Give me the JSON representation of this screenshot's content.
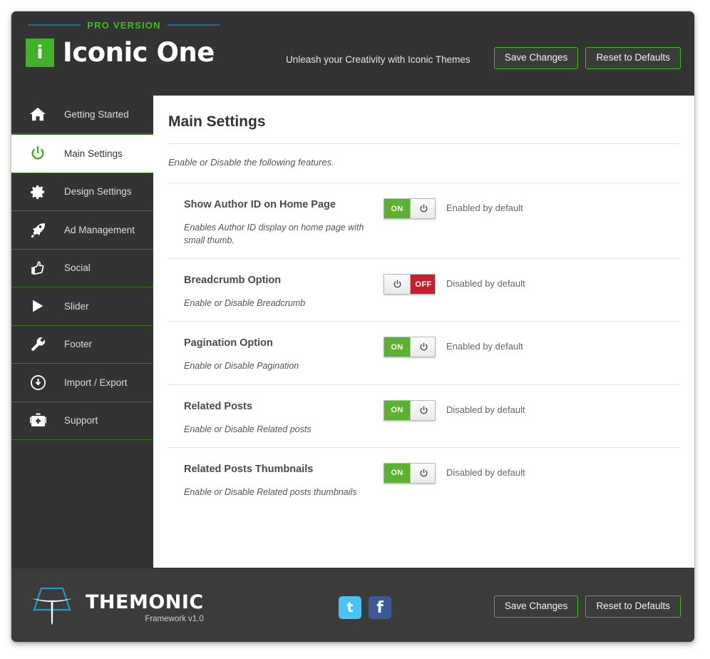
{
  "header": {
    "pro_label": "PRO  VERSION",
    "logo_mark": "i",
    "logo_text": "Iconic One",
    "tagline": "Unleash your Creativity with Iconic Themes",
    "save_label": "Save Changes",
    "reset_label": "Reset to Defaults"
  },
  "sidebar": {
    "items": [
      {
        "label": "Getting Started",
        "icon": "home-icon",
        "active": false
      },
      {
        "label": "Main Settings",
        "icon": "power-icon",
        "active": true
      },
      {
        "label": "Design Settings",
        "icon": "gear-icon",
        "active": false
      },
      {
        "label": "Ad Management",
        "icon": "rocket-icon",
        "active": false
      },
      {
        "label": "Social",
        "icon": "thumbs-up-icon",
        "active": false
      },
      {
        "label": "Slider",
        "icon": "play-icon",
        "active": false
      },
      {
        "label": "Footer",
        "icon": "wrench-icon",
        "active": false
      },
      {
        "label": "Import / Export",
        "icon": "download-circle-icon",
        "active": false
      },
      {
        "label": "Support",
        "icon": "briefcase-medical-icon",
        "active": false
      }
    ]
  },
  "main": {
    "title": "Main Settings",
    "subtitle": "Enable or Disable the following features.",
    "settings": [
      {
        "title": "Show Author ID on Home Page",
        "description": "Enables Author ID display on home page with small thumb.",
        "toggle_state": "ON",
        "toggle_label": "ON",
        "note": "Enabled by default"
      },
      {
        "title": "Breadcrumb Option",
        "description": "Enable or Disable Breadcrumb",
        "toggle_state": "OFF",
        "toggle_label": "OFF",
        "note": "Disabled by default"
      },
      {
        "title": "Pagination Option",
        "description": "Enable or Disable Pagination",
        "toggle_state": "ON",
        "toggle_label": "ON",
        "note": "Enabled by default"
      },
      {
        "title": "Related Posts",
        "description": "Enable or Disable Related posts",
        "toggle_state": "ON",
        "toggle_label": "ON",
        "note": "Disabled by default"
      },
      {
        "title": "Related Posts Thumbnails",
        "description": "Enable or Disable Related posts thumbnails",
        "toggle_state": "ON",
        "toggle_label": "ON",
        "note": "Disabled by default"
      }
    ]
  },
  "footer": {
    "brand_name": "THEMONIC",
    "brand_sub": "Framework v1.0",
    "social": [
      {
        "name": "twitter",
        "glyph": "t"
      },
      {
        "name": "facebook",
        "glyph": "f"
      }
    ],
    "save_label": "Save Changes",
    "reset_label": "Reset to Defaults"
  },
  "colors": {
    "accent_green": "#3cc016",
    "toggle_on": "#5cb130",
    "toggle_off": "#c5202f",
    "panel_dark": "#333333",
    "rule_blue": "#1b6a9c",
    "twitter": "#49c3f3",
    "facebook": "#3b5998"
  }
}
